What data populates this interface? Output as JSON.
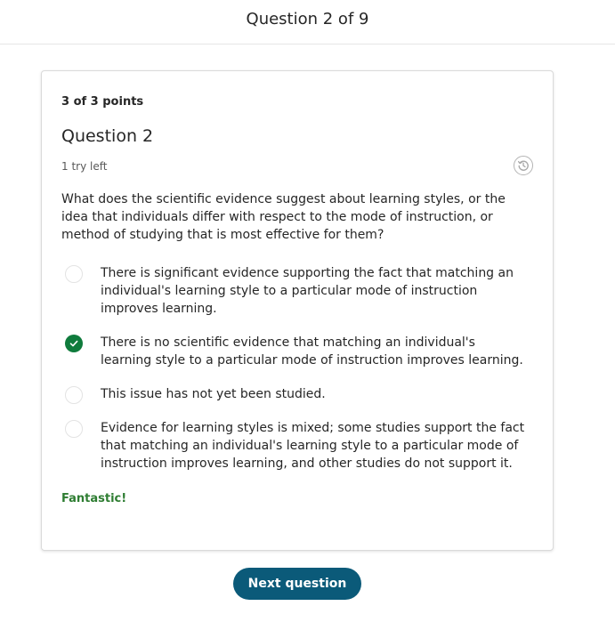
{
  "header": {
    "title": "Question 2 of 9"
  },
  "card": {
    "points": "3 of 3 points",
    "question_title": "Question 2",
    "tries": "1 try left",
    "history_icon": "history-icon",
    "prompt": "What does the scientific evidence suggest about learning styles, or the idea that individuals differ with respect to the mode of instruction, or method of studying that is most effective for them?",
    "options": [
      {
        "label": "There is significant evidence supporting the fact that matching an individual's learning style to a particular mode of instruction improves learning.",
        "selected": false
      },
      {
        "label": "There is no scientific evidence that matching an individual's learning style to a particular mode of instruction improves learning.",
        "selected": true
      },
      {
        "label": "This issue has not yet been studied.",
        "selected": false
      },
      {
        "label": "Evidence for learning styles is mixed; some studies support the fact that matching an individual's learning style to a particular mode of instruction improves learning, and other studies do not support it.",
        "selected": false
      }
    ],
    "feedback": "Fantastic!"
  },
  "footer": {
    "next_label": "Next question"
  },
  "colors": {
    "accent": "#0b5a79",
    "correct": "#0f7b3c",
    "feedback": "#2e7d32"
  }
}
